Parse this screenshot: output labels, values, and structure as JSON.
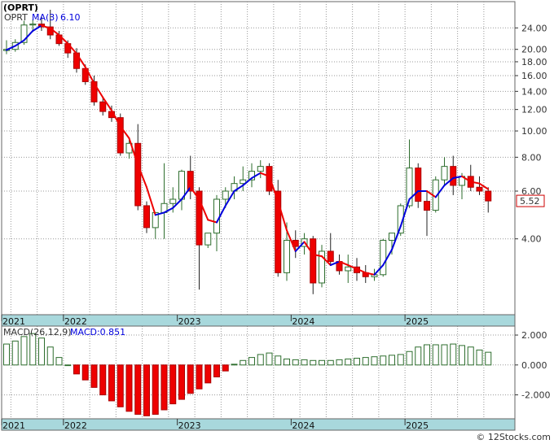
{
  "title": "(OPRT)",
  "price_legend": {
    "symbol": "OPRT",
    "ma_label": "MA(3)",
    "ma_value": "6.10"
  },
  "last_price": "5.52",
  "macd_legend": {
    "label": "MACD(26,12,9)",
    "value_label": "MACD:0.851"
  },
  "watermark": "© 12Stocks.com",
  "years": [
    "2021",
    "2022",
    "2023",
    "2024",
    "2025"
  ],
  "colors": {
    "up": "#2e6e2e",
    "down": "#ee0000",
    "ma_up": "#0000dd",
    "ma_down": "#ee0000",
    "axis_band": "#a8d8dc",
    "grid": "#999999"
  },
  "chart_data": [
    {
      "type": "candlestick",
      "scale": "log",
      "ylim": [
        2.1,
        30
      ],
      "yticks": [
        "24.00",
        "20.00",
        "18.00",
        "16.00",
        "14.00",
        "12.00",
        "10.00",
        "8.00",
        "6.00",
        "4.00"
      ],
      "candles": [
        [
          19.8,
          21.6,
          19.2,
          20.0
        ],
        [
          20.0,
          21.8,
          19.6,
          21.2
        ],
        [
          21.2,
          25.5,
          20.8,
          24.6
        ],
        [
          24.6,
          25.8,
          23.2,
          24.8
        ],
        [
          24.8,
          26.5,
          23.4,
          24.2
        ],
        [
          24.2,
          28.0,
          21.8,
          22.6
        ],
        [
          22.6,
          23.4,
          20.6,
          21.0
        ],
        [
          21.0,
          21.6,
          18.6,
          19.4
        ],
        [
          19.4,
          20.2,
          16.4,
          17.0
        ],
        [
          17.0,
          17.6,
          14.8,
          15.2
        ],
        [
          15.2,
          16.0,
          12.4,
          12.8
        ],
        [
          12.8,
          13.4,
          11.4,
          11.8
        ],
        [
          11.8,
          12.4,
          10.8,
          11.2
        ],
        [
          11.2,
          11.6,
          8.1,
          8.3
        ],
        [
          8.3,
          9.3,
          7.9,
          9.0
        ],
        [
          9.0,
          10.6,
          5.1,
          5.3
        ],
        [
          5.3,
          5.5,
          4.2,
          4.4
        ],
        [
          4.4,
          5.0,
          4.0,
          5.0
        ],
        [
          5.0,
          7.6,
          4.0,
          5.4
        ],
        [
          5.4,
          6.2,
          5.0,
          5.6
        ],
        [
          5.6,
          7.2,
          5.1,
          7.1
        ],
        [
          7.1,
          8.1,
          5.6,
          6.0
        ],
        [
          6.0,
          6.2,
          2.6,
          3.8
        ],
        [
          3.8,
          4.2,
          3.7,
          4.2
        ],
        [
          4.2,
          5.8,
          3.6,
          5.6
        ],
        [
          5.6,
          6.2,
          5.2,
          6.0
        ],
        [
          6.0,
          6.8,
          5.6,
          6.4
        ],
        [
          6.4,
          7.4,
          6.0,
          6.6
        ],
        [
          6.6,
          7.6,
          6.2,
          7.1
        ],
        [
          7.1,
          7.8,
          6.7,
          7.4
        ],
        [
          7.4,
          7.6,
          5.8,
          6.0
        ],
        [
          6.0,
          6.6,
          2.9,
          3.0
        ],
        [
          3.0,
          4.6,
          2.8,
          3.95
        ],
        [
          3.95,
          4.3,
          3.4,
          3.75
        ],
        [
          3.75,
          4.2,
          3.5,
          4.0
        ],
        [
          4.0,
          4.1,
          2.5,
          2.75
        ],
        [
          2.75,
          3.8,
          2.65,
          3.6
        ],
        [
          3.6,
          4.2,
          3.2,
          3.3
        ],
        [
          3.3,
          3.5,
          2.95,
          3.05
        ],
        [
          3.05,
          3.5,
          2.75,
          3.15
        ],
        [
          3.15,
          3.4,
          2.8,
          3.0
        ],
        [
          3.0,
          3.2,
          2.75,
          2.9
        ],
        [
          2.9,
          3.1,
          2.8,
          2.95
        ],
        [
          2.95,
          4.0,
          2.9,
          3.95
        ],
        [
          3.95,
          4.2,
          3.5,
          4.2
        ],
        [
          4.2,
          5.4,
          4.1,
          5.3
        ],
        [
          5.3,
          9.3,
          5.2,
          7.3
        ],
        [
          7.3,
          7.6,
          5.2,
          5.5
        ],
        [
          5.5,
          6.0,
          4.1,
          5.1
        ],
        [
          5.1,
          6.8,
          5.0,
          6.6
        ],
        [
          6.6,
          8.0,
          6.3,
          7.4
        ],
        [
          7.4,
          8.1,
          5.8,
          6.3
        ],
        [
          6.3,
          7.0,
          5.6,
          6.8
        ],
        [
          6.8,
          7.5,
          6.0,
          6.2
        ],
        [
          6.2,
          6.8,
          5.8,
          6.0
        ],
        [
          6.0,
          6.2,
          5.0,
          5.52
        ]
      ],
      "ma": [
        19.9,
        20.6,
        21.6,
        23.4,
        24.5,
        23.9,
        22.6,
        21.0,
        19.3,
        17.2,
        15.0,
        13.3,
        11.9,
        10.4,
        9.4,
        7.5,
        6.2,
        4.9,
        5.0,
        5.2,
        5.6,
        6.2,
        5.6,
        4.7,
        4.6,
        5.3,
        6.0,
        6.3,
        6.7,
        7.0,
        6.8,
        5.5,
        4.3,
        3.6,
        3.9,
        3.5,
        3.45,
        3.2,
        3.3,
        3.2,
        3.1,
        3.0,
        2.95,
        3.2,
        3.65,
        4.45,
        5.6,
        6.0,
        6.0,
        5.7,
        6.3,
        6.7,
        6.8,
        6.5,
        6.4,
        6.1
      ]
    },
    {
      "type": "bar",
      "series": [
        {
          "name": "MACD",
          "values": [
            1.4,
            1.6,
            1.9,
            2.1,
            1.8,
            1.2,
            0.5,
            0.0,
            -0.6,
            -1.0,
            -1.5,
            -2.0,
            -2.4,
            -2.8,
            -3.1,
            -3.3,
            -3.4,
            -3.3,
            -3.0,
            -2.6,
            -2.3,
            -1.9,
            -1.6,
            -1.2,
            -0.8,
            -0.4,
            0.05,
            0.3,
            0.5,
            0.7,
            0.8,
            0.6,
            0.4,
            0.35,
            0.35,
            0.3,
            0.3,
            0.3,
            0.35,
            0.4,
            0.45,
            0.5,
            0.55,
            0.6,
            0.65,
            0.7,
            0.9,
            1.2,
            1.35,
            1.35,
            1.35,
            1.4,
            1.3,
            1.2,
            1.0,
            0.851
          ]
        }
      ],
      "ylim": [
        -3.6,
        2.6
      ],
      "yticks": [
        "2.000",
        "0.000",
        "-2.000"
      ]
    }
  ]
}
